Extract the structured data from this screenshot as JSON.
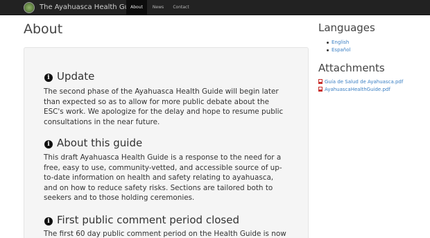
{
  "navbar": {
    "brand": "The Ayahuasca Health Guide",
    "items": [
      {
        "label": "About"
      },
      {
        "label": "News"
      },
      {
        "label": "Contact"
      }
    ]
  },
  "main": {
    "title": "About",
    "sections": [
      {
        "heading": "Update",
        "body": "The second phase of the Ayahuasca Health Guide will begin later than expected so as to allow for more public debate about the ESC's work. We apologize for the delay and hope to resume public consultations in the near future."
      },
      {
        "heading": "About this guide",
        "body": "This draft Ayahuasca Health Guide is a response to the need for a free, easy to use, community-vetted, and accessible source of up-to-date information on health and safety relating to ayahuasca, and on how to reduce safety risks. Sections are tailored both to seekers and to those holding ceremonies."
      },
      {
        "heading": "First public comment period closed",
        "body": "The first 60 day public comment period on the Health Guide is now"
      }
    ]
  },
  "sidebar": {
    "languages_title": "Languages",
    "languages": [
      "English",
      "Español"
    ],
    "attachments_title": "Attachments",
    "attachments": [
      "Guía de Salud de Ayahuasca.pdf",
      "AyahuascaHealthGuide.pdf"
    ]
  },
  "icons": {
    "brand": "brand-logo-icon",
    "section": "info-circle-icon",
    "attachment": "pdf-file-icon"
  },
  "colors": {
    "navbar": "#222222",
    "active_nav": "#0c0c0c",
    "link": "#3a7fc4",
    "well": "#f5f5f5"
  }
}
